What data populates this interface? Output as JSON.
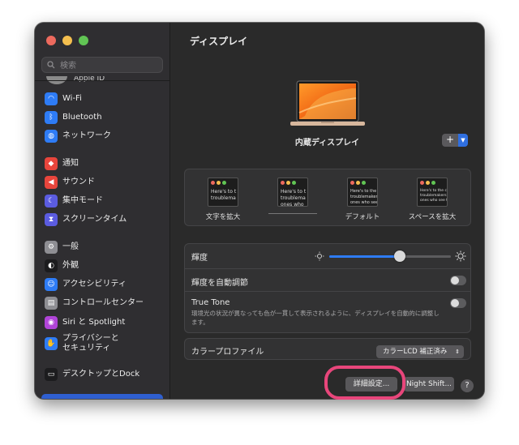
{
  "window": {
    "traffic": [
      "#ed6a5e",
      "#f5bf4f",
      "#61c554"
    ]
  },
  "sidebar": {
    "search_placeholder": "検索",
    "account_label": "Apple ID",
    "items": [
      {
        "label": "Wi-Fi",
        "icon": "wifi-icon",
        "color": "#2e7cf6",
        "glyph": "◠"
      },
      {
        "label": "Bluetooth",
        "icon": "bluetooth-icon",
        "color": "#2e7cf6",
        "glyph": "ᛒ"
      },
      {
        "label": "ネットワーク",
        "icon": "globe-icon",
        "color": "#2e7cf6",
        "glyph": "◍"
      },
      {
        "label": "通知",
        "icon": "bell-icon",
        "color": "#e8453c",
        "glyph": "◆"
      },
      {
        "label": "サウンド",
        "icon": "speaker-icon",
        "color": "#e8453c",
        "glyph": "◀"
      },
      {
        "label": "集中モード",
        "icon": "moon-icon",
        "color": "#5b5ce0",
        "glyph": "☾"
      },
      {
        "label": "スクリーンタイム",
        "icon": "hourglass-icon",
        "color": "#5b5ce0",
        "glyph": "⧗"
      },
      {
        "label": "一般",
        "icon": "gear-icon",
        "color": "#8e8e93",
        "glyph": "⚙"
      },
      {
        "label": "外観",
        "icon": "appearance-icon",
        "color": "#1c1c1e",
        "glyph": "◐"
      },
      {
        "label": "アクセシビリティ",
        "icon": "accessibility-icon",
        "color": "#2e7cf6",
        "glyph": "☺"
      },
      {
        "label": "コントロールセンター",
        "icon": "control-center-icon",
        "color": "#8e8e93",
        "glyph": "▤"
      },
      {
        "label": "Siri と Spotlight",
        "icon": "siri-icon",
        "color": "#b044d8",
        "glyph": "◉"
      },
      {
        "label": "プライバシーと\nセキュリティ",
        "icon": "hand-icon",
        "color": "#2e7cf6",
        "glyph": "✋"
      },
      {
        "label": "デスクトップとDock",
        "icon": "dock-icon",
        "color": "#1c1c1e",
        "glyph": "▭"
      }
    ]
  },
  "main": {
    "title": "ディスプレイ",
    "display_name": "内蔵ディスプレイ",
    "add_label": "+",
    "resolution_options": [
      {
        "label": "文字を拡大",
        "preview": "Here's to t\ntroublema"
      },
      {
        "label": "",
        "preview": "Here's to t\ntroublema\nones who"
      },
      {
        "label": "デフォルト",
        "preview": "Here's to the\ntroublemakers\nones who see..."
      },
      {
        "label": "スペースを拡大",
        "preview": "Here's to the crazy\ntroublemakers. The\nones who see things"
      }
    ],
    "brightness_label": "輝度",
    "brightness_value": 0.58,
    "auto_brightness_label": "輝度を自動調節",
    "true_tone_label": "True Tone",
    "true_tone_desc": "環境光の状況が異なっても色が一貫して表示されるように、ディスプレイを自動的に調整します。",
    "color_profile_label": "カラープロファイル",
    "color_profile_value": "カラーLCD 補正済み",
    "advanced_button": "詳細設定...",
    "night_shift_button": "Night Shift...",
    "help_label": "?"
  }
}
